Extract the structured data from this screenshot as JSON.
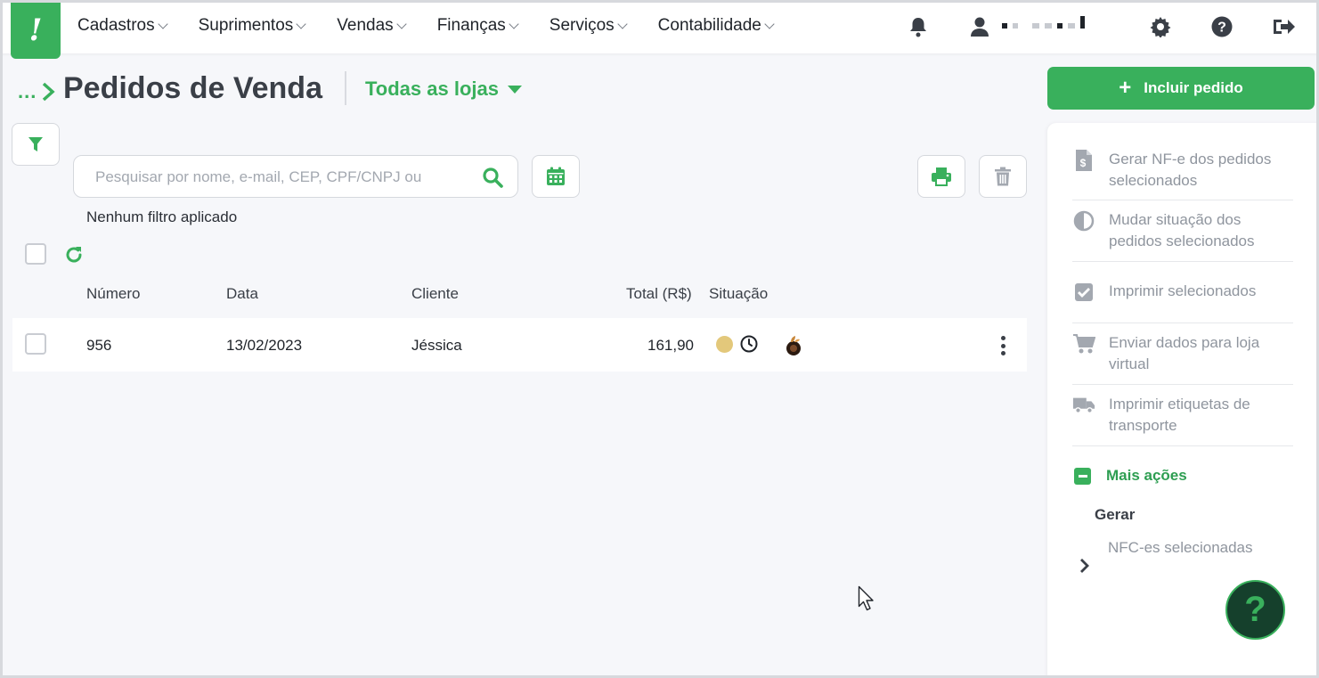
{
  "nav": {
    "logo_letter": "!",
    "items": [
      {
        "label": "Cadastros"
      },
      {
        "label": "Suprimentos"
      },
      {
        "label": "Vendas"
      },
      {
        "label": "Finanças"
      },
      {
        "label": "Serviços"
      },
      {
        "label": "Contabilidade"
      }
    ],
    "icons": [
      "bell-icon",
      "user-icon",
      "gear-icon",
      "help-icon",
      "logout-icon"
    ]
  },
  "header": {
    "breadcrumb_dots": "...",
    "title": "Pedidos de Venda",
    "store_select": "Todas as lojas"
  },
  "search": {
    "placeholder": "Pesquisar por nome, e-mail, CEP, CPF/CNPJ ou",
    "value": ""
  },
  "filters": {
    "note": "Nenhum filtro aplicado"
  },
  "table": {
    "columns": [
      "Número",
      "Data",
      "Cliente",
      "Total (R$)",
      "Situação"
    ],
    "rows": [
      {
        "numero": "956",
        "data": "13/02/2023",
        "cliente": "Jéssica",
        "total": "161,90",
        "status_color": "#e3c87b"
      }
    ]
  },
  "sidebar": {
    "include_button": "Incluir pedido",
    "actions": [
      {
        "label": "Gerar NF-e dos pedidos selecionados",
        "icon": "invoice-icon"
      },
      {
        "label": "Mudar situação dos pedidos selecionados",
        "icon": "half-circle-icon"
      },
      {
        "label": "Imprimir selecionados",
        "icon": "check-square-icon"
      },
      {
        "label": "Enviar dados para loja virtual",
        "icon": "cart-icon"
      },
      {
        "label": "Imprimir etiquetas de transporte",
        "icon": "truck-icon"
      }
    ],
    "more_actions": "Mais ações",
    "section_label": "Gerar",
    "nfc_label": "NFC-es selecionadas",
    "help_glyph": "?"
  },
  "colors": {
    "accent": "#39b05c",
    "muted_text": "#8f959e",
    "status_pending": "#e3c87b"
  }
}
